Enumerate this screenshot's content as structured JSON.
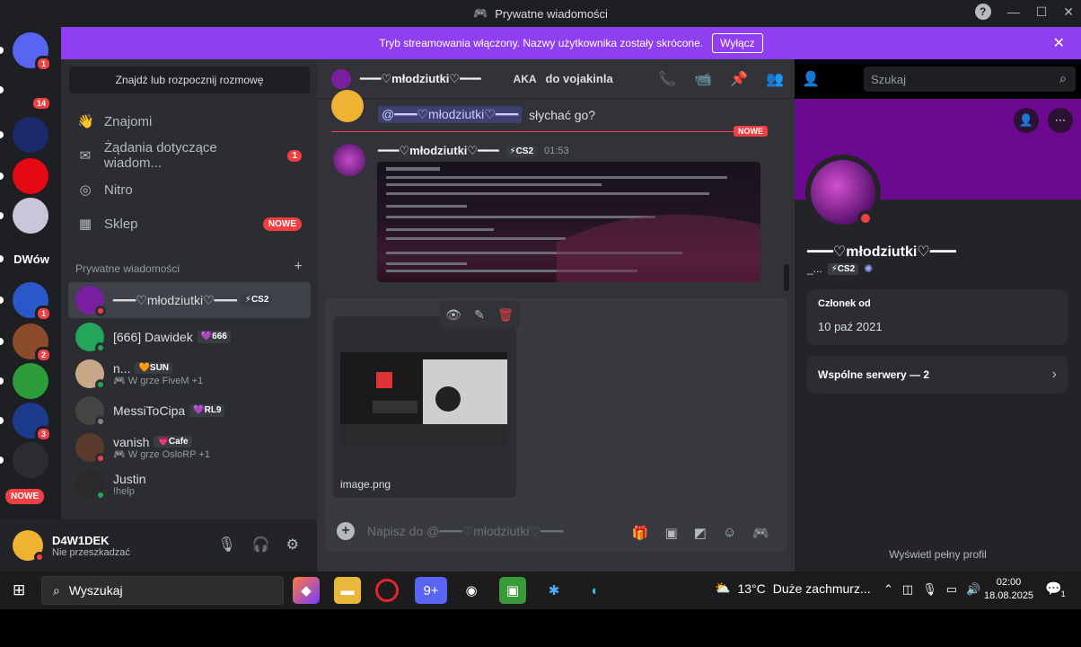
{
  "window": {
    "title": "Prywatne wiadomości"
  },
  "banner": {
    "text": "Tryb streamowania włączony. Nazwy użytkownika zostały skrócone.",
    "button": "Wyłącz"
  },
  "rail": {
    "servers": [
      {
        "name": "discord-home",
        "badge": "1",
        "color": "#5865f2"
      },
      {
        "name": "bell",
        "badge": "14",
        "color": "#1e1f22"
      },
      {
        "name": "server-shop",
        "badge": "",
        "color": "#1a2a6c"
      },
      {
        "name": "server-netflix",
        "badge": "",
        "color": "#e50914"
      },
      {
        "name": "server-anime",
        "badge": "",
        "color": "#c7c7d9"
      },
      {
        "name": "server-dwow",
        "badge": "",
        "color": "#1e1f22",
        "label": "DWów"
      },
      {
        "name": "server-blue",
        "badge": "1",
        "color": "#2a57c9"
      },
      {
        "name": "server-wood",
        "badge": "2",
        "color": "#8a4b2a"
      },
      {
        "name": "server-e",
        "badge": "",
        "color": "#2d9c3a"
      },
      {
        "name": "server-nfc",
        "badge": "3",
        "color": "#1b3b8c"
      },
      {
        "name": "server-robot",
        "badge": "",
        "color": "#2b2d31"
      }
    ],
    "nowe": "NOWE"
  },
  "sidebar": {
    "find": "Znajdź lub rozpocznij rozmowę",
    "nav": [
      {
        "label": "Znajomi"
      },
      {
        "label": "Żądania dotyczące wiadom...",
        "badge": "1"
      },
      {
        "label": "Nitro"
      },
      {
        "label": "Sklep",
        "nowe": "NOWE"
      }
    ],
    "section": "Prywatne wiadomości",
    "dms": [
      {
        "name": "━━━♡młodziutki♡━━━",
        "tag": "⚡CS2",
        "sub": "",
        "color": "#7a1fa0",
        "status": "#f23f43"
      },
      {
        "name": "[666] Dawidek",
        "tag": "💜666",
        "sub": "",
        "color": "#23a55a",
        "status": "#23a55a"
      },
      {
        "name": "n...",
        "tag": "🧡SUN",
        "sub": "🎮 W grze FiveM +1",
        "color": "#c9a88a",
        "status": "#23a55a"
      },
      {
        "name": "MessiToCipa",
        "tag": "💜RL9",
        "sub": "",
        "color": "#444",
        "status": "#80848e"
      },
      {
        "name": "vanish",
        "tag": "💗Cafe",
        "sub": "🎮 W grze OsloRP +1",
        "color": "#5a3a2a",
        "status": "#f23f43"
      },
      {
        "name": "Justin",
        "tag": "",
        "sub": "!help",
        "color": "#2a2a2a",
        "status": "#23a55a"
      }
    ]
  },
  "user": {
    "name": "D4W1DEK",
    "status": "Nie przeszkadzać"
  },
  "chat": {
    "header_name": "━━━♡młodziutki♡━━━",
    "aka": "AKA",
    "aka_name": "do vojakinla",
    "prev_mention": "@━━━♡młodziutki♡━━━",
    "prev_text": "słychać go?",
    "new_tag": "NOWE",
    "msg_author": "━━━♡młodziutki♡━━━",
    "msg_tag": "⚡CS2",
    "msg_time": "01:53",
    "attachment_name": "image.png",
    "input_placeholder": "Napisz do @━━━♡młodziutki♡━━━"
  },
  "search": {
    "placeholder": "Szukaj"
  },
  "profile": {
    "name": "━━━♡młodziutki♡━━━",
    "sub_short": "_...",
    "tag": "⚡CS2",
    "member_label": "Członek od",
    "member_since": "10 paź 2021",
    "mutual": "Wspólne serwery — 2",
    "full": "Wyświetl pełny profil"
  },
  "taskbar": {
    "search": "Wyszukaj",
    "weather_temp": "13°C",
    "weather_desc": "Duże zachmurz...",
    "time": "02:00",
    "date": "18.08.2025",
    "notif": "1"
  }
}
